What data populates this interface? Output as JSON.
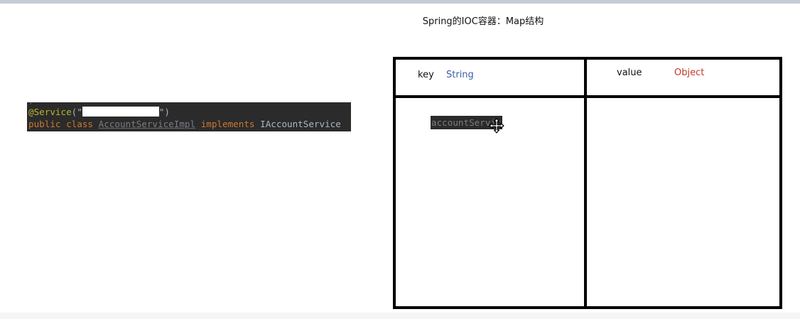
{
  "slide": {
    "title": "Spring的IOC容器：Map结构"
  },
  "code": {
    "line0": ")",
    "annotation": "@Service",
    "paren_open": "(\"",
    "paren_close": "\")",
    "kw_public": "public",
    "kw_class": "class",
    "class_name": "AccountServiceImpl",
    "kw_implements": "implements",
    "interface_name": "IAccountService"
  },
  "map_table": {
    "key_label": "key",
    "key_type": "String",
    "value_label": "value",
    "value_type": "Object",
    "entry_key": "accountServic"
  },
  "colors": {
    "key_type": "#3b5da8",
    "value_type": "#c0392b",
    "code_background": "#2b2b2b",
    "annotation": "#bbb529",
    "keyword": "#cc7832"
  },
  "icons": {
    "cursor": "move-cursor-icon"
  }
}
